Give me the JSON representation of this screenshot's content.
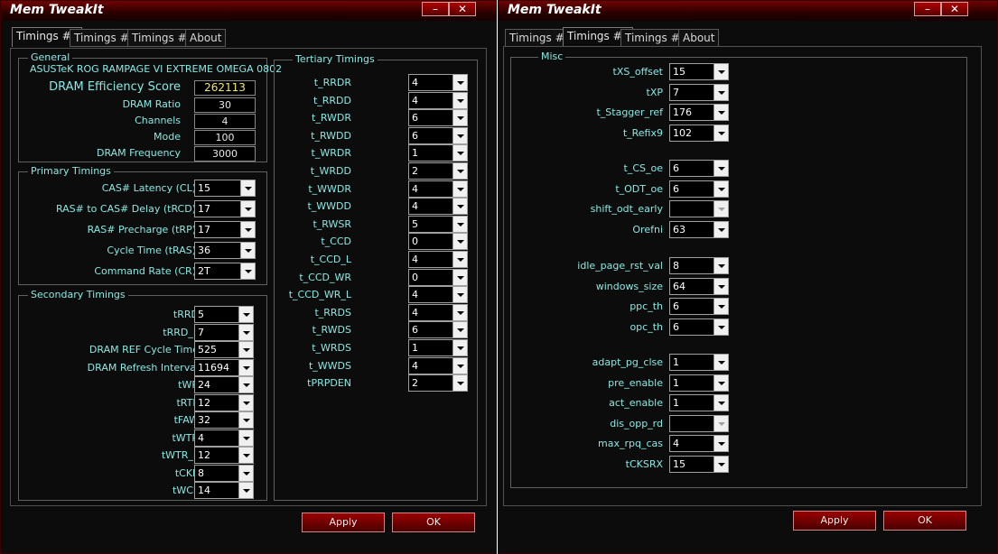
{
  "app_title": "Mem TweakIt",
  "window_buttons": {
    "minimize": "–",
    "close": "✕"
  },
  "tabs": [
    "Timings #1",
    "Timings #2",
    "Timings #3",
    "About"
  ],
  "buttons": {
    "apply": "Apply",
    "ok": "OK"
  },
  "window1": {
    "general": {
      "label": "General",
      "board": "ASUSTeK ROG RAMPAGE VI EXTREME OMEGA 0802",
      "efficiency_label": "DRAM Efficiency Score",
      "efficiency_value": "262113",
      "rows": [
        {
          "label": "DRAM Ratio",
          "value": "30"
        },
        {
          "label": "Channels",
          "value": "4"
        },
        {
          "label": "Mode",
          "value": "100"
        },
        {
          "label": "DRAM Frequency",
          "value": "3000"
        }
      ]
    },
    "primary": {
      "label": "Primary Timings",
      "rows": [
        {
          "label": "CAS# Latency (CL)",
          "value": "15"
        },
        {
          "label": "RAS# to CAS# Delay (tRCD)",
          "value": "17"
        },
        {
          "label": "RAS# Precharge (tRP)",
          "value": "17"
        },
        {
          "label": "Cycle Time (tRAS)",
          "value": "36"
        },
        {
          "label": "Command Rate (CR)",
          "value": "2T"
        }
      ]
    },
    "secondary": {
      "label": "Secondary Timings",
      "rows": [
        {
          "label": "tRRD",
          "value": "5"
        },
        {
          "label": "tRRD_L",
          "value": "7"
        },
        {
          "label": "DRAM REF Cycle Time",
          "value": "525"
        },
        {
          "label": "DRAM Refresh Interval",
          "value": "11694"
        },
        {
          "label": "tWR",
          "value": "24"
        },
        {
          "label": "tRTP",
          "value": "12"
        },
        {
          "label": "tFAW",
          "value": "32"
        },
        {
          "label": "tWTR",
          "value": "4"
        },
        {
          "label": "tWTR_L",
          "value": "12"
        },
        {
          "label": "tCKE",
          "value": "8"
        },
        {
          "label": "tWCL",
          "value": "14"
        }
      ]
    },
    "tertiary": {
      "label": "Tertiary Timings",
      "rows": [
        {
          "label": "t_RRDR",
          "value": "4"
        },
        {
          "label": "t_RRDD",
          "value": "4"
        },
        {
          "label": "t_RWDR",
          "value": "6"
        },
        {
          "label": "t_RWDD",
          "value": "6"
        },
        {
          "label": "t_WRDR",
          "value": "1"
        },
        {
          "label": "t_WRDD",
          "value": "2"
        },
        {
          "label": "t_WWDR",
          "value": "4"
        },
        {
          "label": "t_WWDD",
          "value": "4"
        },
        {
          "label": "t_RWSR",
          "value": "5"
        },
        {
          "label": "t_CCD",
          "value": "0"
        },
        {
          "label": "t_CCD_L",
          "value": "4"
        },
        {
          "label": "t_CCD_WR",
          "value": "0"
        },
        {
          "label": "t_CCD_WR_L",
          "value": "4"
        },
        {
          "label": "t_RRDS",
          "value": "4"
        },
        {
          "label": "t_RWDS",
          "value": "6"
        },
        {
          "label": "t_WRDS",
          "value": "1"
        },
        {
          "label": "t_WWDS",
          "value": "4"
        },
        {
          "label": "tPRPDEN",
          "value": "2"
        }
      ]
    }
  },
  "window2": {
    "misc_label": "Misc",
    "groups": [
      [
        {
          "label": "tXS_offset",
          "value": "15"
        },
        {
          "label": "tXP",
          "value": "7"
        },
        {
          "label": "t_Stagger_ref",
          "value": "176"
        },
        {
          "label": "t_Refix9",
          "value": "102"
        }
      ],
      [
        {
          "label": "t_CS_oe",
          "value": "6"
        },
        {
          "label": "t_ODT_oe",
          "value": "6"
        },
        {
          "label": "shift_odt_early",
          "value": ""
        },
        {
          "label": "Orefni",
          "value": "63"
        }
      ],
      [
        {
          "label": "idle_page_rst_val",
          "value": "8"
        },
        {
          "label": "windows_size",
          "value": "64"
        },
        {
          "label": "ppc_th",
          "value": "6"
        },
        {
          "label": "opc_th",
          "value": "6"
        }
      ],
      [
        {
          "label": "adapt_pg_clse",
          "value": "1"
        },
        {
          "label": "pre_enable",
          "value": "1"
        },
        {
          "label": "act_enable",
          "value": "1"
        },
        {
          "label": "dis_opp_rd",
          "value": ""
        },
        {
          "label": "max_rpq_cas",
          "value": "4"
        },
        {
          "label": "tCKSRX",
          "value": "15"
        }
      ]
    ]
  }
}
